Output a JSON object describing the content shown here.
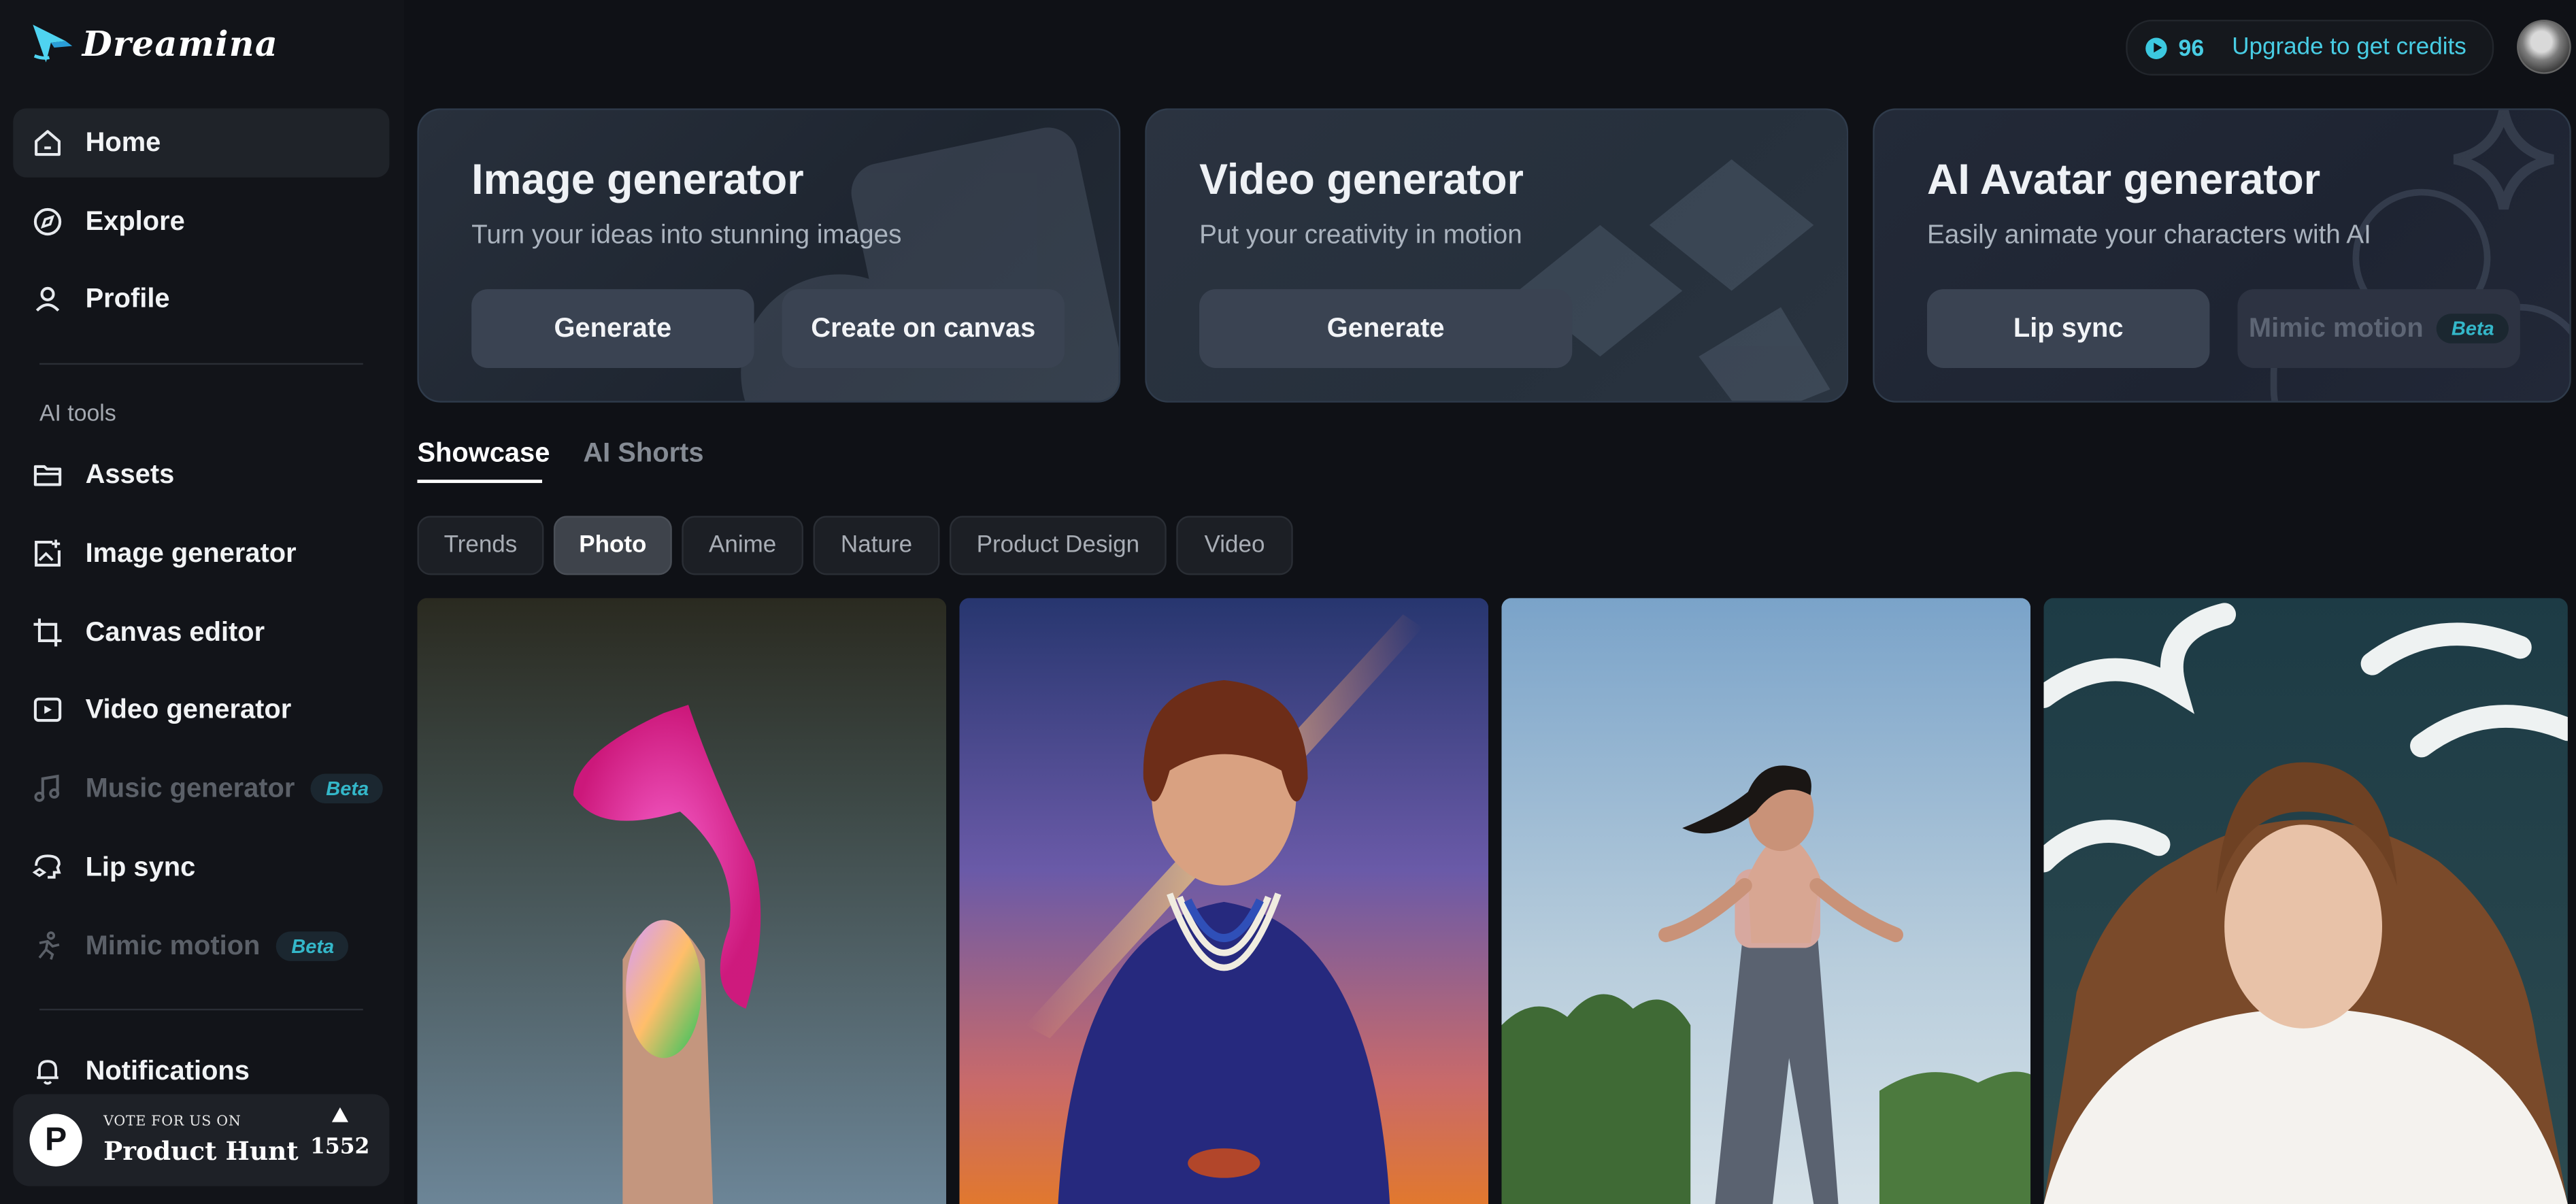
{
  "app": {
    "name": "Dreamina"
  },
  "sidebar": {
    "nav": [
      {
        "label": "Home",
        "icon": "home-icon"
      },
      {
        "label": "Explore",
        "icon": "compass-icon"
      },
      {
        "label": "Profile",
        "icon": "user-icon"
      }
    ],
    "tools_label": "AI tools",
    "tools": [
      {
        "label": "Assets",
        "icon": "folder-icon"
      },
      {
        "label": "Image generator",
        "icon": "image-plus-icon"
      },
      {
        "label": "Canvas editor",
        "icon": "crop-icon"
      },
      {
        "label": "Video generator",
        "icon": "video-plus-icon"
      },
      {
        "label": "Music generator",
        "icon": "music-note-icon",
        "badge": "Beta"
      },
      {
        "label": "Lip sync",
        "icon": "lip-sync-icon"
      },
      {
        "label": "Mimic motion",
        "icon": "motion-icon",
        "badge": "Beta"
      }
    ],
    "notifications": {
      "label": "Notifications",
      "icon": "bell-icon"
    },
    "product_hunt": {
      "small": "VOTE FOR US ON",
      "name": "Product Hunt",
      "logo_letter": "P",
      "count": "1552"
    }
  },
  "header": {
    "credits": "96",
    "upgrade_label": "Upgrade to get credits"
  },
  "cards": [
    {
      "title": "Image generator",
      "subtitle": "Turn your ideas into stunning images",
      "buttons": [
        "Generate",
        "Create on canvas"
      ]
    },
    {
      "title": "Video generator",
      "subtitle": "Put your creativity in motion",
      "buttons": [
        "Generate"
      ]
    },
    {
      "title": "AI Avatar generator",
      "subtitle": "Easily animate your characters with AI",
      "buttons": [
        "Lip sync",
        "Mimic motion"
      ],
      "badge": "Beta"
    }
  ],
  "tabs": [
    "Showcase",
    "AI Shorts"
  ],
  "filters": [
    "Trends",
    "Photo",
    "Anime",
    "Nature",
    "Product Design",
    "Video"
  ],
  "active_filter": "Photo",
  "gallery": [
    {
      "name": "neon-flame-fingernail-image"
    },
    {
      "name": "woman-pearl-necklace-image"
    },
    {
      "name": "woman-running-image"
    },
    {
      "name": "woman-in-snow-image"
    }
  ],
  "colors": {
    "accent": "#48cde4",
    "background": "#0f1116",
    "sidebar": "#121419",
    "card_button": "#3a4352",
    "beta": "#34b7c9"
  }
}
